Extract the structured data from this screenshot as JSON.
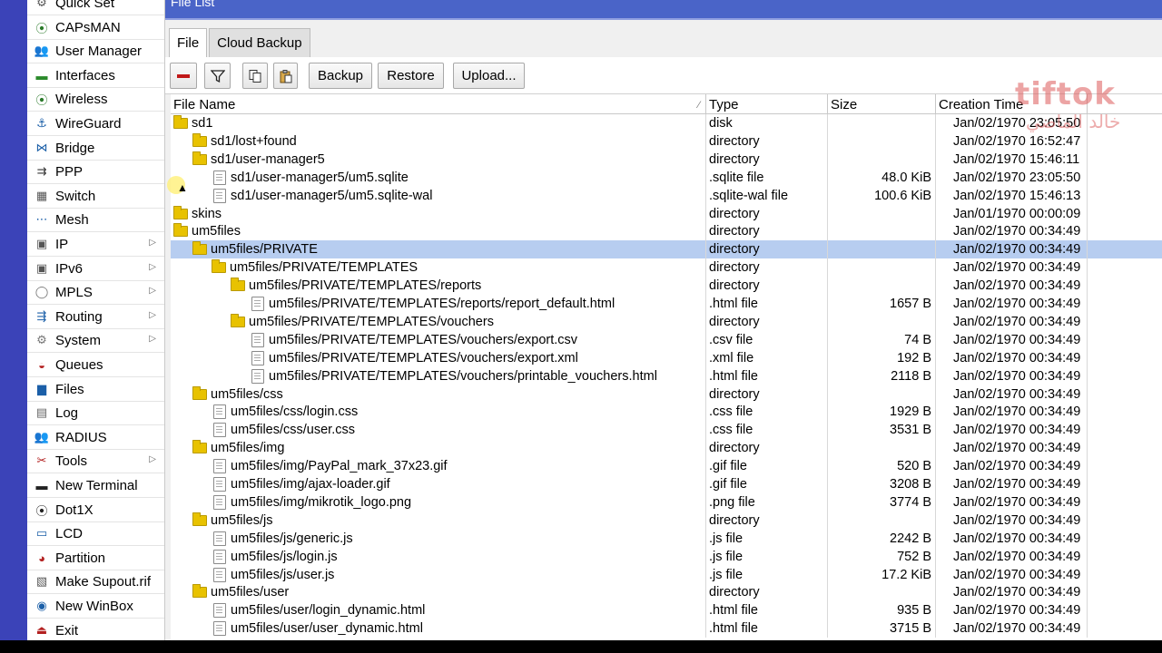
{
  "window": {
    "title": "File List"
  },
  "sidebar": {
    "items": [
      {
        "label": "Quick Set",
        "icon": "quick-set-icon",
        "glyph": "⚙",
        "color": "#555"
      },
      {
        "label": "CAPsMAN",
        "icon": "capsman-icon",
        "glyph": "⦿",
        "color": "#2a7a2a"
      },
      {
        "label": "User Manager",
        "icon": "user-manager-icon",
        "glyph": "👥",
        "color": "#2b5fb4"
      },
      {
        "label": "Interfaces",
        "icon": "interfaces-icon",
        "glyph": "▬",
        "color": "#2a8a2a"
      },
      {
        "label": "Wireless",
        "icon": "wireless-icon",
        "glyph": "⦿",
        "color": "#2a7a2a"
      },
      {
        "label": "WireGuard",
        "icon": "wireguard-icon",
        "glyph": "⚓",
        "color": "#1b5fa8"
      },
      {
        "label": "Bridge",
        "icon": "bridge-icon",
        "glyph": "⋈",
        "color": "#1b5fa8"
      },
      {
        "label": "PPP",
        "icon": "ppp-icon",
        "glyph": "⇉",
        "color": "#333"
      },
      {
        "label": "Switch",
        "icon": "switch-icon",
        "glyph": "▦",
        "color": "#555"
      },
      {
        "label": "Mesh",
        "icon": "mesh-icon",
        "glyph": "⋯",
        "color": "#1b5fa8"
      },
      {
        "label": "IP",
        "icon": "ip-icon",
        "glyph": "▣",
        "color": "#555",
        "submenu": true
      },
      {
        "label": "IPv6",
        "icon": "ipv6-icon",
        "glyph": "▣",
        "color": "#555",
        "submenu": true
      },
      {
        "label": "MPLS",
        "icon": "mpls-icon",
        "glyph": "◯",
        "color": "#777",
        "submenu": true
      },
      {
        "label": "Routing",
        "icon": "routing-icon",
        "glyph": "⇶",
        "color": "#1b5fa8",
        "submenu": true
      },
      {
        "label": "System",
        "icon": "system-icon",
        "glyph": "⚙",
        "color": "#777",
        "submenu": true
      },
      {
        "label": "Queues",
        "icon": "queues-icon",
        "glyph": "◒",
        "color": "#b32020"
      },
      {
        "label": "Files",
        "icon": "files-icon",
        "glyph": "▆",
        "color": "#1b5fa8"
      },
      {
        "label": "Log",
        "icon": "log-icon",
        "glyph": "▤",
        "color": "#666"
      },
      {
        "label": "RADIUS",
        "icon": "radius-icon",
        "glyph": "👥",
        "color": "#2b5fb4"
      },
      {
        "label": "Tools",
        "icon": "tools-icon",
        "glyph": "✂",
        "color": "#b32020",
        "submenu": true
      },
      {
        "label": "New Terminal",
        "icon": "terminal-icon",
        "glyph": "▬",
        "color": "#222"
      },
      {
        "label": "Dot1X",
        "icon": "dot1x-icon",
        "glyph": "⦿",
        "color": "#222"
      },
      {
        "label": "LCD",
        "icon": "lcd-icon",
        "glyph": "▭",
        "color": "#1b5fa8"
      },
      {
        "label": "Partition",
        "icon": "partition-icon",
        "glyph": "◕",
        "color": "#b32020"
      },
      {
        "label": "Make Supout.rif",
        "icon": "supout-icon",
        "glyph": "▧",
        "color": "#555"
      },
      {
        "label": "New WinBox",
        "icon": "winbox-icon",
        "glyph": "◉",
        "color": "#1b5fa8"
      },
      {
        "label": "Exit",
        "icon": "exit-icon",
        "glyph": "⏏",
        "color": "#b32020"
      }
    ]
  },
  "tabs": [
    {
      "label": "File",
      "active": true
    },
    {
      "label": "Cloud Backup",
      "active": false
    }
  ],
  "toolbar": {
    "backup_label": "Backup",
    "restore_label": "Restore",
    "upload_label": "Upload..."
  },
  "table": {
    "columns": {
      "name": "File Name",
      "type": "Type",
      "size": "Size",
      "time": "Creation Time"
    },
    "rows": [
      {
        "name": "sd1",
        "type": "disk",
        "size": "",
        "time": "Jan/02/1970 23:05:50",
        "depth": 0,
        "kind": "folder"
      },
      {
        "name": "sd1/lost+found",
        "type": "directory",
        "size": "",
        "time": "Jan/02/1970 16:52:47",
        "depth": 1,
        "kind": "folder"
      },
      {
        "name": "sd1/user-manager5",
        "type": "directory",
        "size": "",
        "time": "Jan/02/1970 15:46:11",
        "depth": 1,
        "kind": "folder"
      },
      {
        "name": "sd1/user-manager5/um5.sqlite",
        "type": ".sqlite file",
        "size": "48.0 KiB",
        "time": "Jan/02/1970 23:05:50",
        "depth": 2,
        "kind": "file"
      },
      {
        "name": "sd1/user-manager5/um5.sqlite-wal",
        "type": ".sqlite-wal file",
        "size": "100.6 KiB",
        "time": "Jan/02/1970 15:46:13",
        "depth": 2,
        "kind": "file"
      },
      {
        "name": "skins",
        "type": "directory",
        "size": "",
        "time": "Jan/01/1970 00:00:09",
        "depth": 0,
        "kind": "folder"
      },
      {
        "name": "um5files",
        "type": "directory",
        "size": "",
        "time": "Jan/02/1970 00:34:49",
        "depth": 0,
        "kind": "folder"
      },
      {
        "name": "um5files/PRIVATE",
        "type": "directory",
        "size": "",
        "time": "Jan/02/1970 00:34:49",
        "depth": 1,
        "kind": "folder",
        "selected": true
      },
      {
        "name": "um5files/PRIVATE/TEMPLATES",
        "type": "directory",
        "size": "",
        "time": "Jan/02/1970 00:34:49",
        "depth": 2,
        "kind": "folder"
      },
      {
        "name": "um5files/PRIVATE/TEMPLATES/reports",
        "type": "directory",
        "size": "",
        "time": "Jan/02/1970 00:34:49",
        "depth": 3,
        "kind": "folder"
      },
      {
        "name": "um5files/PRIVATE/TEMPLATES/reports/report_default.html",
        "type": ".html file",
        "size": "1657 B",
        "time": "Jan/02/1970 00:34:49",
        "depth": 4,
        "kind": "file"
      },
      {
        "name": "um5files/PRIVATE/TEMPLATES/vouchers",
        "type": "directory",
        "size": "",
        "time": "Jan/02/1970 00:34:49",
        "depth": 3,
        "kind": "folder"
      },
      {
        "name": "um5files/PRIVATE/TEMPLATES/vouchers/export.csv",
        "type": ".csv file",
        "size": "74 B",
        "time": "Jan/02/1970 00:34:49",
        "depth": 4,
        "kind": "file"
      },
      {
        "name": "um5files/PRIVATE/TEMPLATES/vouchers/export.xml",
        "type": ".xml file",
        "size": "192 B",
        "time": "Jan/02/1970 00:34:49",
        "depth": 4,
        "kind": "file"
      },
      {
        "name": "um5files/PRIVATE/TEMPLATES/vouchers/printable_vouchers.html",
        "type": ".html file",
        "size": "2118 B",
        "time": "Jan/02/1970 00:34:49",
        "depth": 4,
        "kind": "file"
      },
      {
        "name": "um5files/css",
        "type": "directory",
        "size": "",
        "time": "Jan/02/1970 00:34:49",
        "depth": 1,
        "kind": "folder"
      },
      {
        "name": "um5files/css/login.css",
        "type": ".css file",
        "size": "1929 B",
        "time": "Jan/02/1970 00:34:49",
        "depth": 2,
        "kind": "file"
      },
      {
        "name": "um5files/css/user.css",
        "type": ".css file",
        "size": "3531 B",
        "time": "Jan/02/1970 00:34:49",
        "depth": 2,
        "kind": "file"
      },
      {
        "name": "um5files/img",
        "type": "directory",
        "size": "",
        "time": "Jan/02/1970 00:34:49",
        "depth": 1,
        "kind": "folder"
      },
      {
        "name": "um5files/img/PayPal_mark_37x23.gif",
        "type": ".gif file",
        "size": "520 B",
        "time": "Jan/02/1970 00:34:49",
        "depth": 2,
        "kind": "file"
      },
      {
        "name": "um5files/img/ajax-loader.gif",
        "type": ".gif file",
        "size": "3208 B",
        "time": "Jan/02/1970 00:34:49",
        "depth": 2,
        "kind": "file"
      },
      {
        "name": "um5files/img/mikrotik_logo.png",
        "type": ".png file",
        "size": "3774 B",
        "time": "Jan/02/1970 00:34:49",
        "depth": 2,
        "kind": "file"
      },
      {
        "name": "um5files/js",
        "type": "directory",
        "size": "",
        "time": "Jan/02/1970 00:34:49",
        "depth": 1,
        "kind": "folder"
      },
      {
        "name": "um5files/js/generic.js",
        "type": ".js file",
        "size": "2242 B",
        "time": "Jan/02/1970 00:34:49",
        "depth": 2,
        "kind": "file"
      },
      {
        "name": "um5files/js/login.js",
        "type": ".js file",
        "size": "752 B",
        "time": "Jan/02/1970 00:34:49",
        "depth": 2,
        "kind": "file"
      },
      {
        "name": "um5files/js/user.js",
        "type": ".js file",
        "size": "17.2 KiB",
        "time": "Jan/02/1970 00:34:49",
        "depth": 2,
        "kind": "file"
      },
      {
        "name": "um5files/user",
        "type": "directory",
        "size": "",
        "time": "Jan/02/1970 00:34:49",
        "depth": 1,
        "kind": "folder"
      },
      {
        "name": "um5files/user/login_dynamic.html",
        "type": ".html file",
        "size": "935 B",
        "time": "Jan/02/1970 00:34:49",
        "depth": 2,
        "kind": "file"
      },
      {
        "name": "um5files/user/user_dynamic.html",
        "type": ".html file",
        "size": "3715 B",
        "time": "Jan/02/1970 00:34:49",
        "depth": 2,
        "kind": "file"
      }
    ]
  },
  "watermark": {
    "brand": "tiftok",
    "name": "خالد الماضي"
  },
  "colors": {
    "titlebar": "#4a64c8",
    "selected_row": "#b7cdf0",
    "folder": "#e8c200",
    "frame_blue": "#3b43b8"
  }
}
